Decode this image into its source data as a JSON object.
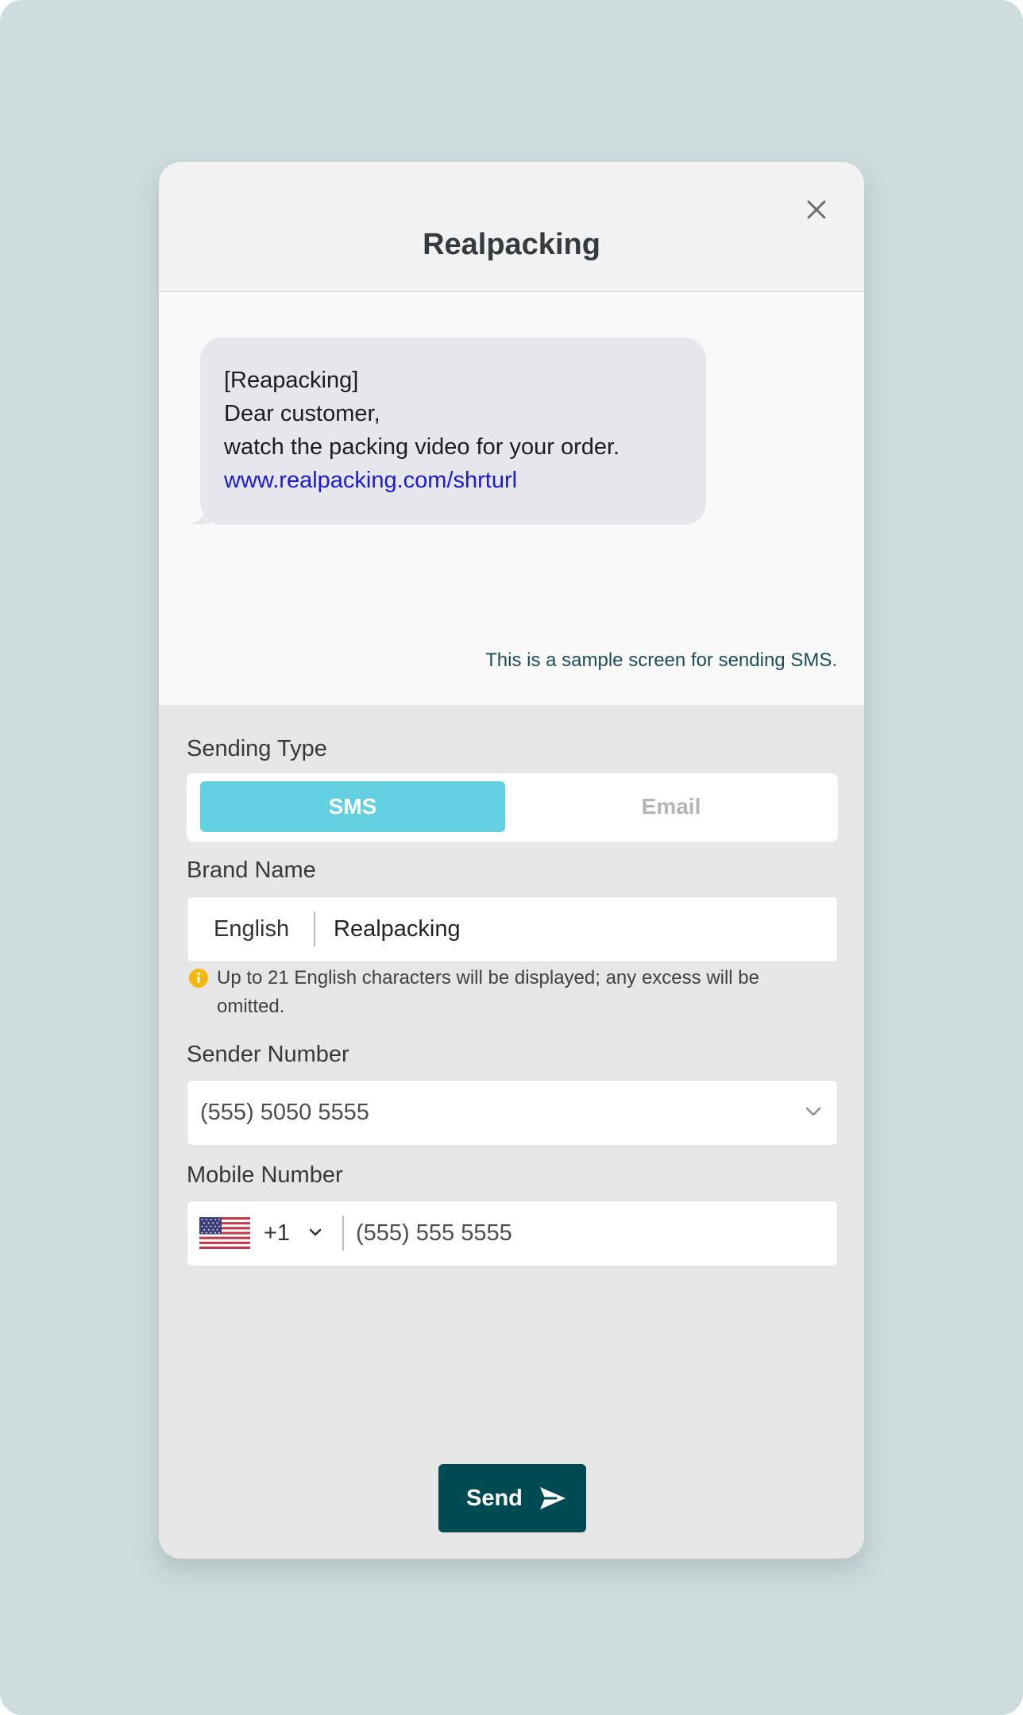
{
  "modal": {
    "title": "Realpacking",
    "close_icon": "close-icon"
  },
  "preview": {
    "message_lines": [
      "[Reapacking]",
      "Dear customer,",
      "watch the packing video for your order."
    ],
    "link": "www.realpacking.com/shrturl",
    "note": "This is a sample screen for sending SMS."
  },
  "form": {
    "sending_type": {
      "label": "Sending Type",
      "options": [
        "SMS",
        "Email"
      ],
      "selected": "SMS"
    },
    "brand_name": {
      "label": "Brand Name",
      "language": "English",
      "value": "Realpacking",
      "help": "Up to 21 English characters will be displayed; any excess will be omitted.",
      "help_icon": "info-icon"
    },
    "sender_number": {
      "label": "Sender Number",
      "value": "(555) 5050 5555",
      "icon": "chevron-down-icon"
    },
    "mobile_number": {
      "label": "Mobile Number",
      "country_flag": "us-flag-icon",
      "country_code": "+1",
      "value": "(555) 555 5555"
    },
    "send_button": {
      "label": "Send",
      "icon": "send-icon"
    }
  },
  "colors": {
    "page_background": "#cddbdc",
    "primary": "#004a53",
    "accent": "#63d0e2",
    "link": "#1a1adb",
    "info": "#f5b70f"
  }
}
